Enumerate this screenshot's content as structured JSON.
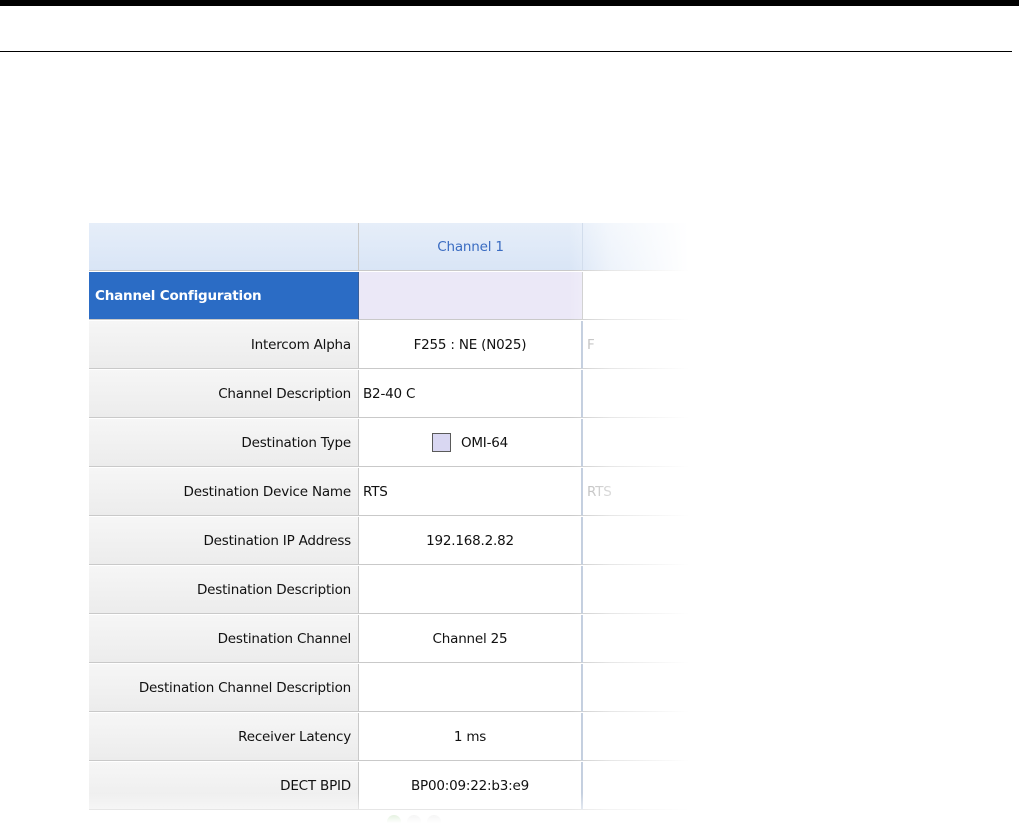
{
  "header": {
    "column_label": "Channel 1"
  },
  "section": {
    "title": "Channel Configuration"
  },
  "rows": [
    {
      "label": "Intercom Alpha",
      "value": "F255 : NE (N025)",
      "next": "F"
    },
    {
      "label": "Channel Description",
      "value": "B2-40 C",
      "next": ""
    },
    {
      "label": "Destination Type",
      "value": "OMI-64",
      "next": ""
    },
    {
      "label": "Destination Device Name",
      "value": "RTS",
      "next": "RTS"
    },
    {
      "label": "Destination IP Address",
      "value": "192.168.2.82",
      "next": ""
    },
    {
      "label": "Destination Description",
      "value": "",
      "next": ""
    },
    {
      "label": "Destination Channel",
      "value": "Channel 25",
      "next": ""
    },
    {
      "label": "Destination Channel Description",
      "value": "",
      "next": ""
    },
    {
      "label": "Receiver Latency",
      "value": "1 ms",
      "next": ""
    },
    {
      "label": "DECT BPID",
      "value": "BP00:09:22:b3:e9",
      "next": ""
    }
  ],
  "colors": {
    "section_blue": "#2b6cc5",
    "header_text_blue": "#3a6cc2",
    "destination_type_swatch": "#d9d7f2"
  },
  "icons": [
    "add-icon"
  ]
}
